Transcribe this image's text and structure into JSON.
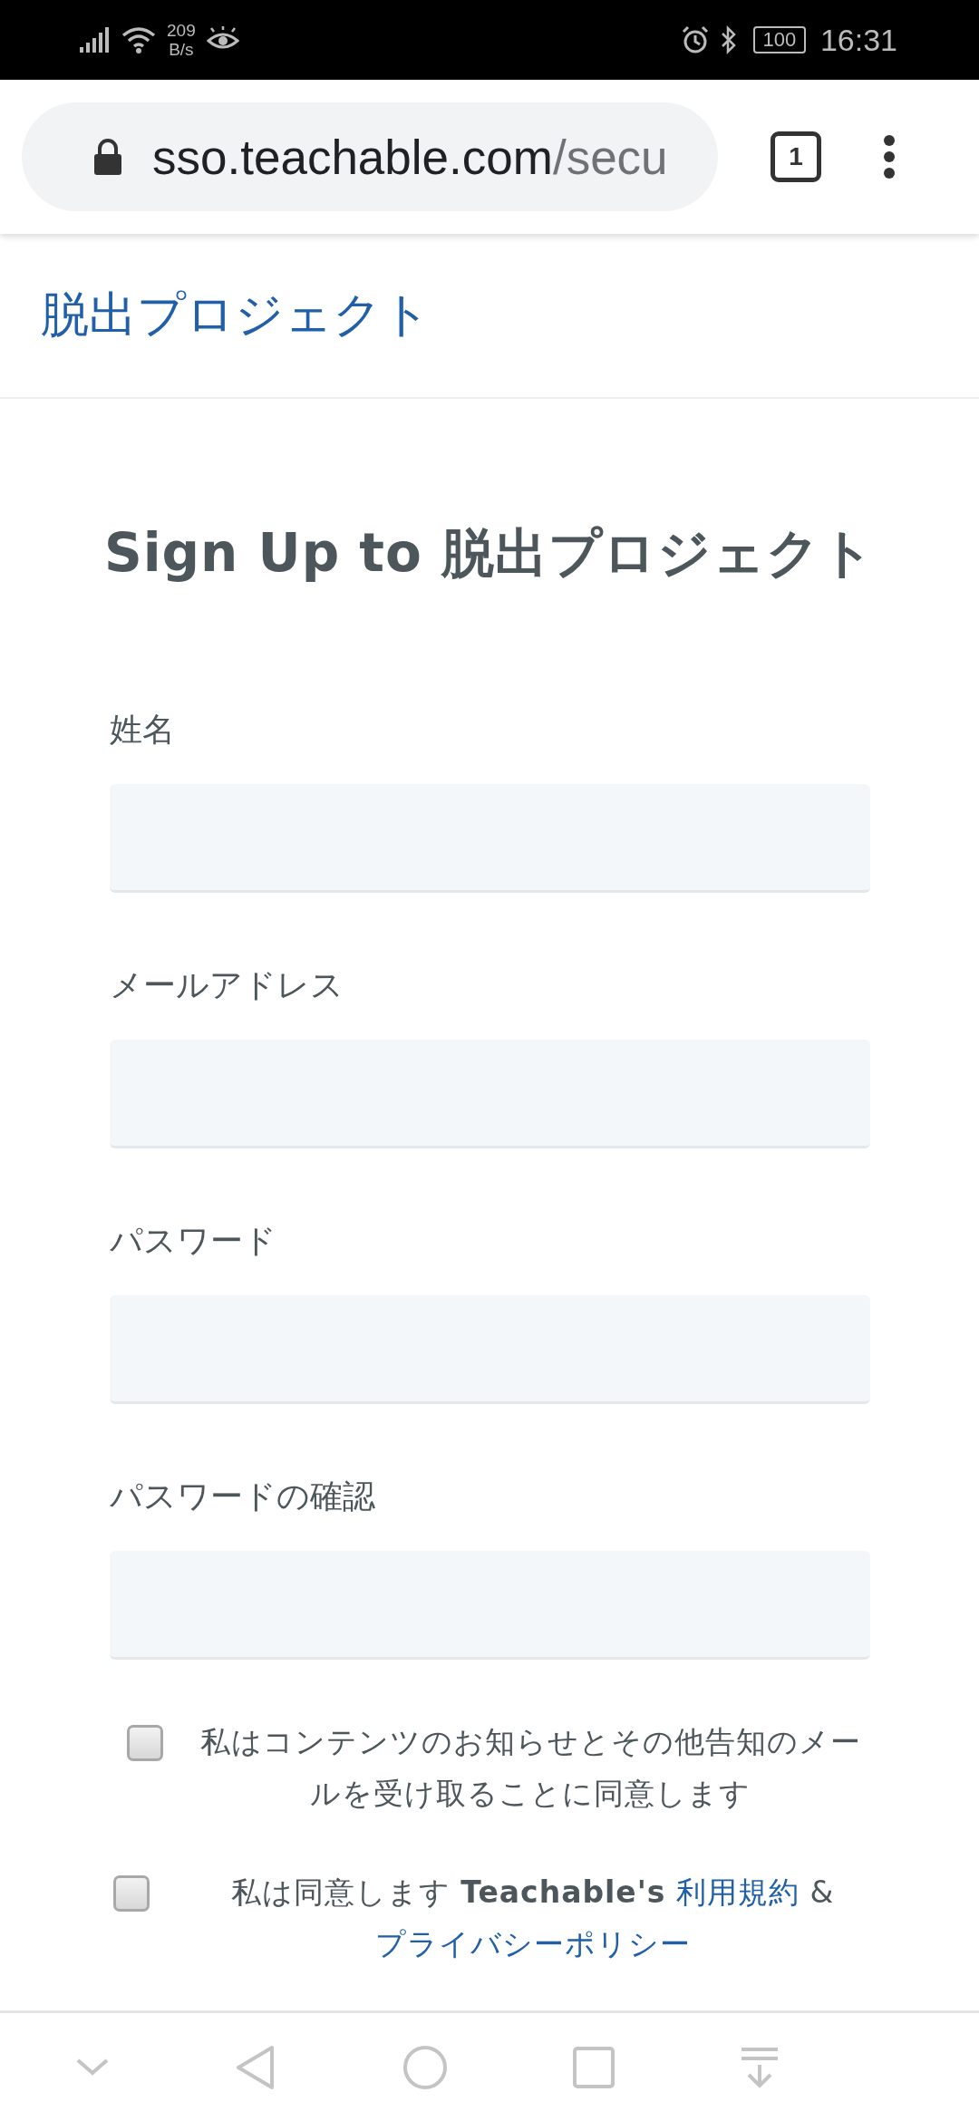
{
  "status_bar": {
    "net_speed": "209",
    "net_unit": "B/s",
    "battery": "100",
    "time": "16:31"
  },
  "browser": {
    "url_host": "sso.teachable.com",
    "url_path": "/secu",
    "tab_count": "1"
  },
  "site_header": {
    "title": "脱出プロジェクト"
  },
  "form": {
    "title": "Sign Up to 脱出プロジェクト",
    "fields": [
      {
        "label": "姓名"
      },
      {
        "label": "メールアドレス"
      },
      {
        "label": "パスワード"
      },
      {
        "label": "パスワードの確認"
      }
    ],
    "consents": [
      {
        "checked": false,
        "parts": [
          {
            "kind": "text",
            "text": "私はコンテンツのお知らせとその他告知のメールを受け取ることに同意します"
          }
        ]
      },
      {
        "checked": false,
        "parts": [
          {
            "kind": "text",
            "text": "私は同意します **Teachable's**"
          },
          {
            "kind": "link",
            "text": "利用規約"
          },
          {
            "kind": "text",
            "text": "&"
          },
          {
            "kind": "link",
            "text": "プライバシーポリシー"
          }
        ]
      }
    ]
  }
}
